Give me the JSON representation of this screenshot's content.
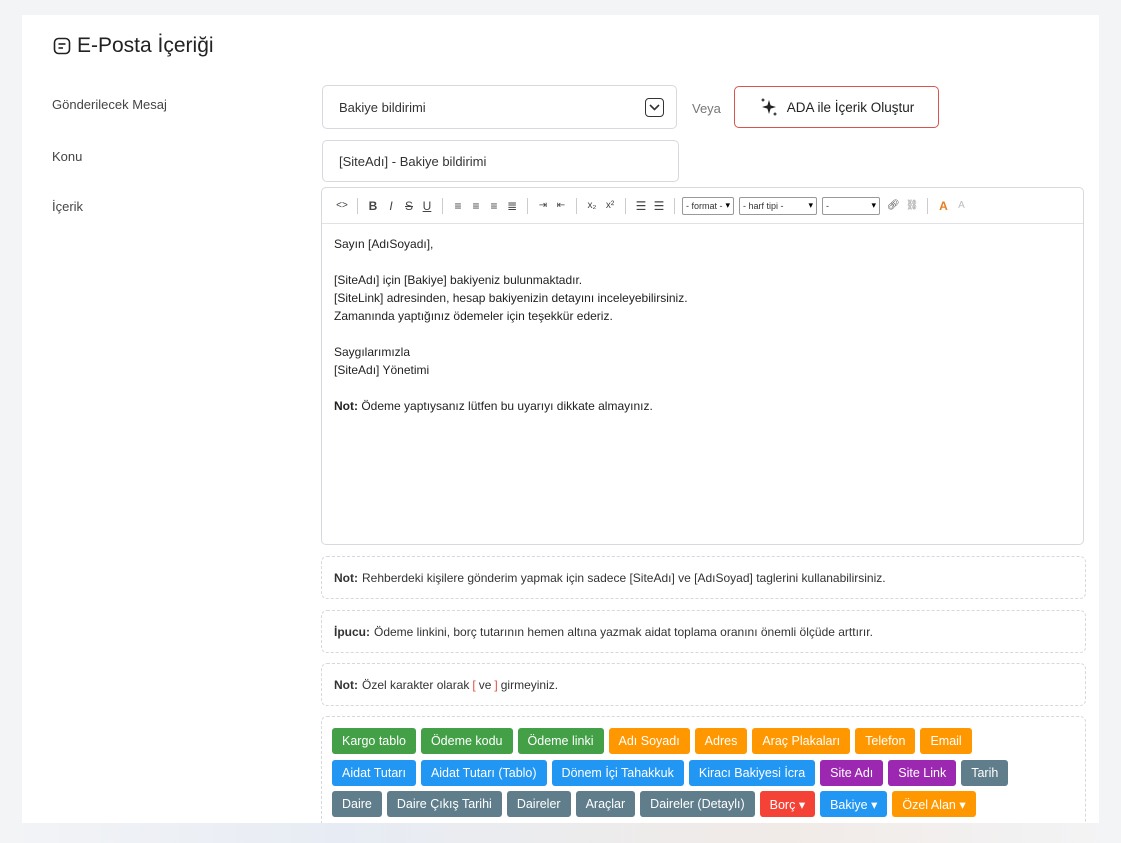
{
  "title": "E-Posta İçeriği",
  "labels": {
    "message": "Gönderilecek Mesaj",
    "subject": "Konu",
    "content": "İçerik"
  },
  "message_select": {
    "value": "Bakiye bildirimi"
  },
  "veya": "Veya",
  "ada_button": "ADA ile İçerik Oluştur",
  "subject_input": {
    "value": "[SiteAdı] - Bakiye bildirimi"
  },
  "toolbar": {
    "format_select": "- format -",
    "font_select": "- harf tipi -",
    "size_select": "-"
  },
  "editor": {
    "lines": [
      "Sayın [AdıSoyadı],",
      "",
      "[SiteAdı] için [Bakiye] bakiyeniz bulunmaktadır.",
      "[SiteLink] adresinden, hesap bakiyenizin detayını inceleyebilirsiniz.",
      "Zamanında yaptığınız ödemeler için teşekkür ederiz.",
      "",
      "Saygılarımızla",
      "[SiteAdı] Yönetimi",
      ""
    ],
    "note_bold": "Not:",
    "note_text": "Ödeme yaptıysanız lütfen bu uyarıyı dikkate almayınız."
  },
  "notes": [
    {
      "bold": "Not:",
      "text": "Rehberdeki kişilere gönderim yapmak için sadece [SiteAdı] ve [AdıSoyad] taglerini kullanabilirsiniz."
    },
    {
      "bold": "İpucu:",
      "text": "Ödeme linkini, borç tutarının hemen altına yazmak aidat toplama oranını önemli ölçüde arttırır."
    }
  ],
  "note3": {
    "bold": "Not:",
    "text_before": "Özel karakter olarak",
    "bracket_open": "[",
    "text_mid": "ve",
    "bracket_close": "]",
    "text_after": "girmeyiniz."
  },
  "tags_row1": [
    {
      "label": "Kargo tablo",
      "color": "#43a047"
    },
    {
      "label": "Ödeme kodu",
      "color": "#43a047"
    },
    {
      "label": "Ödeme linki",
      "color": "#43a047"
    },
    {
      "label": "Adı Soyadı",
      "color": "#ff9800"
    },
    {
      "label": "Adres",
      "color": "#ff9800"
    },
    {
      "label": "Araç Plakaları",
      "color": "#ff9800"
    },
    {
      "label": "Telefon",
      "color": "#ff9800"
    },
    {
      "label": "Email",
      "color": "#ff9800"
    }
  ],
  "tags_row2": [
    {
      "label": "Aidat Tutarı",
      "color": "#2196f3"
    },
    {
      "label": "Aidat Tutarı (Tablo)",
      "color": "#2196f3"
    },
    {
      "label": "Dönem İçi Tahakkuk",
      "color": "#2196f3"
    },
    {
      "label": "Kiracı Bakiyesi İcra",
      "color": "#2196f3"
    },
    {
      "label": "Site Adı",
      "color": "#9c27b0"
    },
    {
      "label": "Site Link",
      "color": "#9c27b0"
    },
    {
      "label": "Tarih",
      "color": "#607d8b"
    }
  ],
  "tags_row3": [
    {
      "label": "Daire",
      "color": "#607d8b"
    },
    {
      "label": "Daire Çıkış Tarihi",
      "color": "#607d8b"
    },
    {
      "label": "Daireler",
      "color": "#607d8b"
    },
    {
      "label": "Araçlar",
      "color": "#607d8b"
    },
    {
      "label": "Daireler (Detaylı)",
      "color": "#607d8b"
    },
    {
      "label": "Borç ▾",
      "color": "#f44336"
    },
    {
      "label": "Bakiye ▾",
      "color": "#2196f3"
    },
    {
      "label": "Özel Alan ▾",
      "color": "#ff9800"
    }
  ]
}
